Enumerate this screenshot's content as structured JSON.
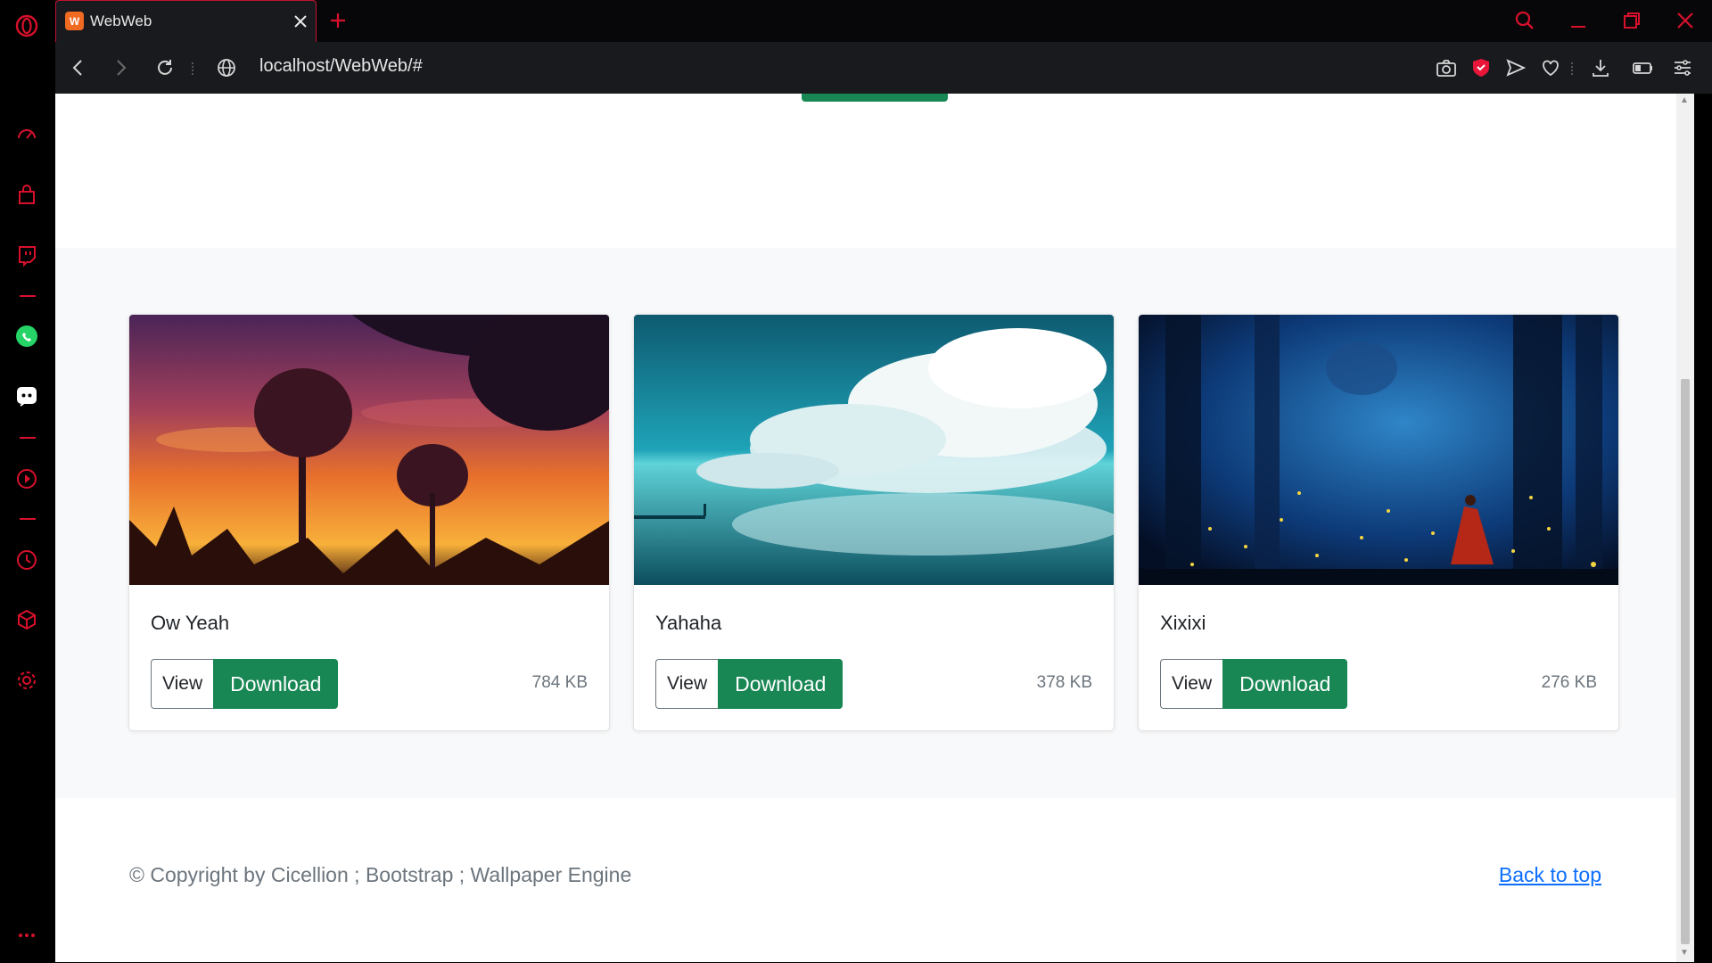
{
  "browser": {
    "tab_title": "WebWeb",
    "favicon_text": "W",
    "url": "localhost/WebWeb/#",
    "accent": "#d8102c"
  },
  "sidebar": {
    "items": [
      "speed-dial-icon",
      "shopping-icon",
      "twitch-icon",
      "whatsapp-icon",
      "discord-icon",
      "player-icon",
      "history-icon",
      "extensions-icon",
      "settings-icon",
      "more-icon"
    ]
  },
  "cards": [
    {
      "title": "Ow Yeah",
      "view_label": "View",
      "download_label": "Download",
      "size": "784 KB"
    },
    {
      "title": "Yahaha",
      "view_label": "View",
      "download_label": "Download",
      "size": "378 KB"
    },
    {
      "title": "Xixixi",
      "view_label": "View",
      "download_label": "Download",
      "size": "276 KB"
    }
  ],
  "footer": {
    "copyright": "© Copyright by Cicellion ; Bootstrap ; Wallpaper Engine",
    "back_to_top": "Back to top"
  },
  "colors": {
    "primary_green": "#198754",
    "link_blue": "#0d6efd"
  }
}
